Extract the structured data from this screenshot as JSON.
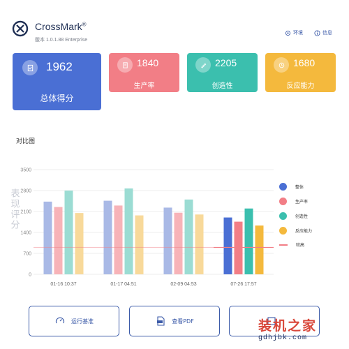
{
  "app": {
    "name": "CrossMark",
    "trademark": "®",
    "version": "版本 1.0.1.88 Enterprise"
  },
  "header_actions": [
    {
      "label": "环境",
      "icon": "gear-icon"
    },
    {
      "label": "信息",
      "icon": "info-icon"
    }
  ],
  "cards": [
    {
      "value": "1962",
      "label": "总体得分",
      "color": "#4a6fd4",
      "icon": "clipboard-check-icon"
    },
    {
      "value": "1840",
      "label": "生产率",
      "color": "#f27e86",
      "icon": "document-list-icon"
    },
    {
      "value": "2205",
      "label": "创造性",
      "color": "#3bbfae",
      "icon": "pen-icon"
    },
    {
      "value": "1680",
      "label": "反应能力",
      "color": "#f4b93d",
      "icon": "clock-icon"
    }
  ],
  "comparison": {
    "title": "对比图"
  },
  "chart_data": {
    "type": "bar",
    "ylabel": "表现评分",
    "ylim": [
      0,
      3500
    ],
    "yticks": [
      0,
      700,
      1400,
      2100,
      2800,
      3500
    ],
    "grid": true,
    "categories": [
      "01-16 10:37",
      "01-17 04:51",
      "02-09 04:53",
      "07-26 17:57"
    ],
    "series": [
      {
        "name": "整体",
        "color": "#4a6fd4",
        "faded_color": "#a9b9e6",
        "values": [
          2430,
          2460,
          2230,
          1900
        ]
      },
      {
        "name": "生产率",
        "color": "#f27e86",
        "faded_color": "#f7b3b8",
        "values": [
          2250,
          2300,
          2060,
          1760
        ]
      },
      {
        "name": "创造性",
        "color": "#3bbfae",
        "faded_color": "#9bdcd3",
        "values": [
          2800,
          2870,
          2500,
          2200
        ]
      },
      {
        "name": "反应能力",
        "color": "#f4b93d",
        "faded_color": "#f8d99a",
        "values": [
          2050,
          1970,
          2000,
          1630
        ]
      }
    ],
    "baseline": {
      "name": "较高",
      "value": 900,
      "color": "#f27e86"
    },
    "highlighted_category": 3,
    "legend_position": "right"
  },
  "actions": [
    {
      "label": "运行基准",
      "icon": "speedometer-icon"
    },
    {
      "label": "查看PDF",
      "icon": "pdf-icon"
    },
    {
      "label": "",
      "icon": "compare-icon"
    }
  ],
  "watermark": {
    "title": "装机之家",
    "url": "gdhjbk.com"
  }
}
